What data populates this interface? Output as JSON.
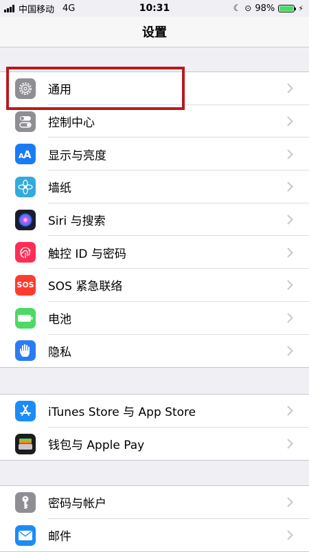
{
  "status": {
    "carrier": "中国移动",
    "network": "4G",
    "time": "10:31",
    "battery_percent": "98%",
    "battery_level": 0.98
  },
  "nav": {
    "title": "设置"
  },
  "groups": [
    {
      "items": [
        {
          "label": "通用",
          "icon": "gear-icon",
          "color": "#8e8e93"
        },
        {
          "label": "控制中心",
          "icon": "switches-icon",
          "color": "#8e8e93"
        },
        {
          "label": "显示与亮度",
          "icon": "text-size-icon",
          "color": "#1a7cf5"
        },
        {
          "label": "墙纸",
          "icon": "flower-icon",
          "color": "#34aadc"
        },
        {
          "label": "Siri 与搜索",
          "icon": "siri-icon",
          "color": "#1c1c2e"
        },
        {
          "label": "触控 ID 与密码",
          "icon": "fingerprint-icon",
          "color": "#ff2d55"
        },
        {
          "label": "SOS 紧急联络",
          "icon": "sos-icon",
          "color": "#ff3b30",
          "icon_text": "SOS"
        },
        {
          "label": "电池",
          "icon": "battery-icon",
          "color": "#4cd964"
        },
        {
          "label": "隐私",
          "icon": "hand-icon",
          "color": "#2b7cf3"
        }
      ]
    },
    {
      "items": [
        {
          "label": "iTunes Store 与 App Store",
          "icon": "app-store-icon",
          "color": "#1a8cf5"
        },
        {
          "label": "钱包与 Apple Pay",
          "icon": "wallet-icon",
          "color": "#1c1c1e"
        }
      ]
    },
    {
      "items": [
        {
          "label": "密码与帐户",
          "icon": "key-icon",
          "color": "#8e8e93"
        },
        {
          "label": "邮件",
          "icon": "mail-icon",
          "color": "#1a8cf5"
        }
      ]
    }
  ],
  "colors": {
    "highlight": "#b8191d",
    "background": "#efeff4"
  }
}
